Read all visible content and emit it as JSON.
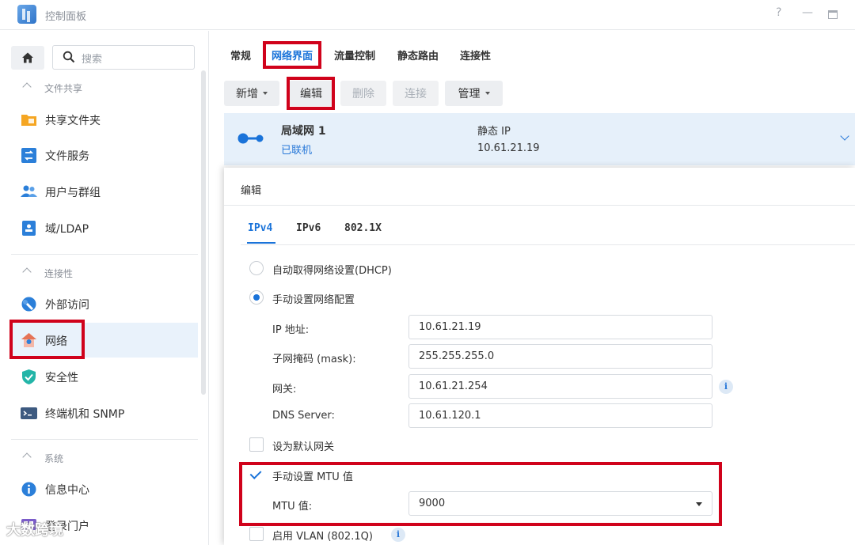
{
  "window": {
    "title": "控制面板",
    "help": "?",
    "minimize": "—"
  },
  "sidebar": {
    "search_placeholder": "搜索",
    "groups": [
      {
        "label": "文件共享"
      },
      {
        "label": "连接性"
      },
      {
        "label": "系统"
      }
    ],
    "items": [
      {
        "label": "共享文件夹",
        "icon": "shared-folder-icon"
      },
      {
        "label": "文件服务",
        "icon": "file-services-icon"
      },
      {
        "label": "用户与群组",
        "icon": "users-icon"
      },
      {
        "label": "域/LDAP",
        "icon": "domain-ldap-icon"
      },
      {
        "label": "外部访问",
        "icon": "external-access-icon"
      },
      {
        "label": "网络",
        "icon": "network-house-icon"
      },
      {
        "label": "安全性",
        "icon": "shield-icon"
      },
      {
        "label": "终端机和 SNMP",
        "icon": "terminal-icon"
      },
      {
        "label": "信息中心",
        "icon": "info-icon"
      },
      {
        "label": "登录门户",
        "icon": "portal-icon"
      }
    ],
    "active_item": "网络"
  },
  "watermark": "大数跨境",
  "tabs": [
    {
      "label": "常规"
    },
    {
      "label": "网络界面"
    },
    {
      "label": "流量控制"
    },
    {
      "label": "静态路由"
    },
    {
      "label": "连接性"
    }
  ],
  "active_tab": "网络界面",
  "toolbar": {
    "new_label": "新增",
    "edit_label": "编辑",
    "delete_label": "删除",
    "connect_label": "连接",
    "manage_label": "管理"
  },
  "interface": {
    "name": "局域网 1",
    "status": "已联机",
    "type": "静态 IP",
    "ip": "10.61.21.19"
  },
  "dialog": {
    "title": "编辑",
    "subtabs": [
      {
        "label": "IPv4"
      },
      {
        "label": "IPv6"
      },
      {
        "label": "802.1X"
      }
    ],
    "active_subtab": "IPv4",
    "dhcp_option": "自动取得网络设置(DHCP)",
    "manual_option": "手动设置网络配置",
    "selected_option": "manual",
    "fields": {
      "ip_label": "IP 地址:",
      "ip_value": "10.61.21.19",
      "mask_label": "子网掩码 (mask):",
      "mask_value": "255.255.255.0",
      "gateway_label": "网关:",
      "gateway_value": "10.61.21.254",
      "dns_label": "DNS Server:",
      "dns_value": "10.61.120.1"
    },
    "default_gateway_label": "设为默认网关",
    "default_gateway_checked": false,
    "mtu_manual_label": "手动设置 MTU 值",
    "mtu_manual_checked": true,
    "mtu_label": "MTU 值:",
    "mtu_value": "9000",
    "vlan_label": "启用 VLAN (802.1Q)",
    "vlan_checked": false,
    "info_glyph": "i"
  },
  "colors": {
    "accent": "#1a73d9",
    "highlight_box": "#d0021b",
    "active_row_bg": "#e6f0fa"
  }
}
